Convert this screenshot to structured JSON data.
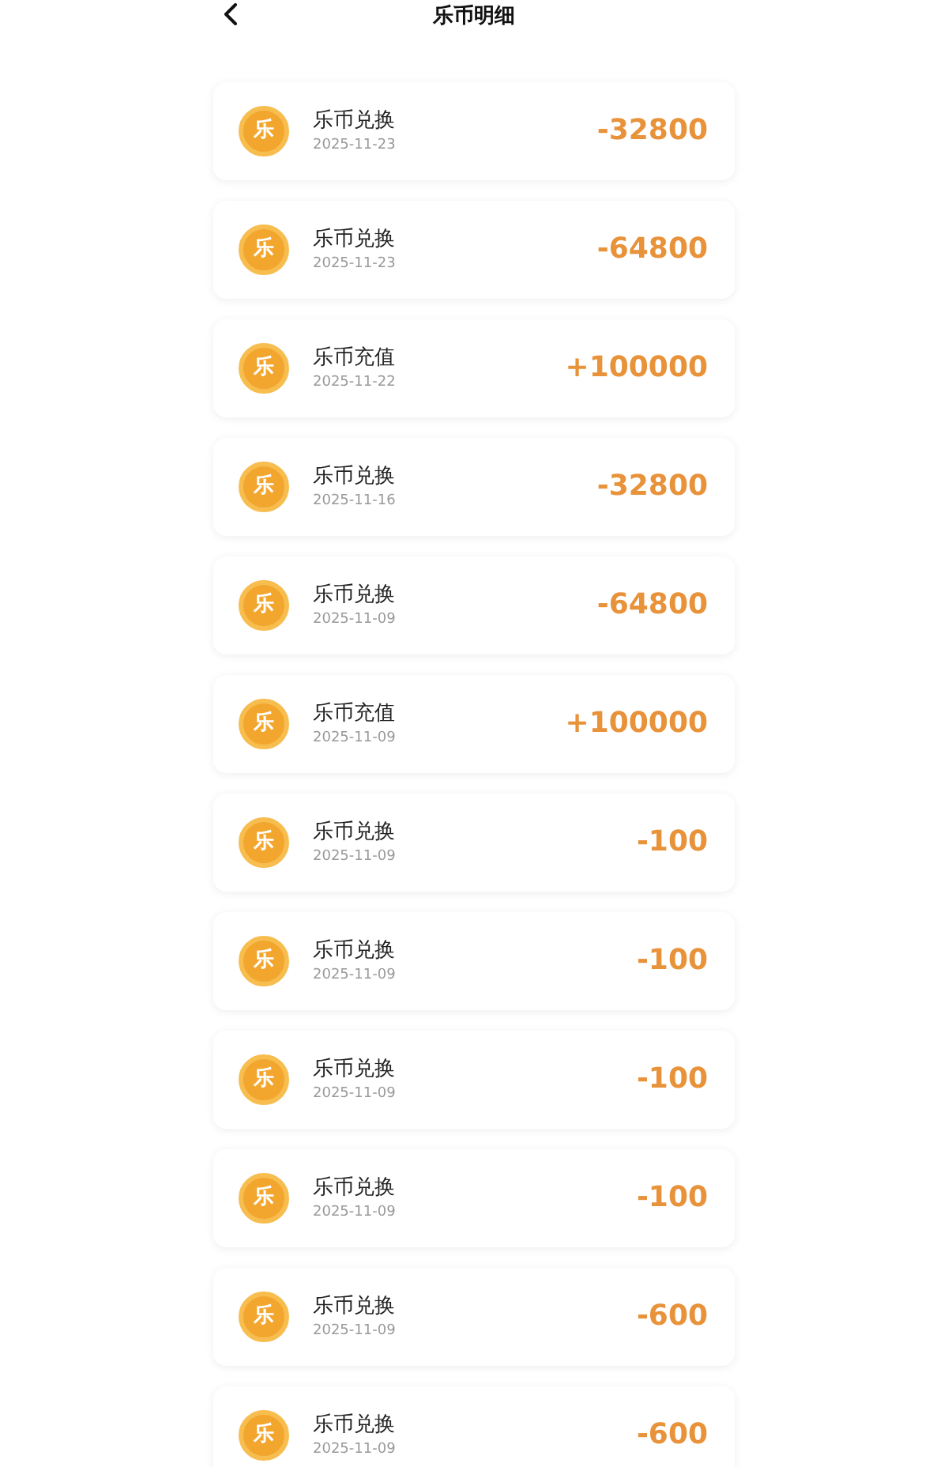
{
  "header": {
    "title": "乐币明细"
  },
  "records": [
    {
      "coin_label": "乐",
      "title": "乐币兑换",
      "date": "2025-11-23",
      "amount": "-32800"
    },
    {
      "coin_label": "乐",
      "title": "乐币兑换",
      "date": "2025-11-23",
      "amount": "-64800"
    },
    {
      "coin_label": "乐",
      "title": "乐币充值",
      "date": "2025-11-22",
      "amount": "+100000"
    },
    {
      "coin_label": "乐",
      "title": "乐币兑换",
      "date": "2025-11-16",
      "amount": "-32800"
    },
    {
      "coin_label": "乐",
      "title": "乐币兑换",
      "date": "2025-11-09",
      "amount": "-64800"
    },
    {
      "coin_label": "乐",
      "title": "乐币充值",
      "date": "2025-11-09",
      "amount": "+100000"
    },
    {
      "coin_label": "乐",
      "title": "乐币兑换",
      "date": "2025-11-09",
      "amount": "-100"
    },
    {
      "coin_label": "乐",
      "title": "乐币兑换",
      "date": "2025-11-09",
      "amount": "-100"
    },
    {
      "coin_label": "乐",
      "title": "乐币兑换",
      "date": "2025-11-09",
      "amount": "-100"
    },
    {
      "coin_label": "乐",
      "title": "乐币兑换",
      "date": "2025-11-09",
      "amount": "-100"
    },
    {
      "coin_label": "乐",
      "title": "乐币兑换",
      "date": "2025-11-09",
      "amount": "-600"
    },
    {
      "coin_label": "乐",
      "title": "乐币兑换",
      "date": "2025-11-09",
      "amount": "-600"
    }
  ]
}
